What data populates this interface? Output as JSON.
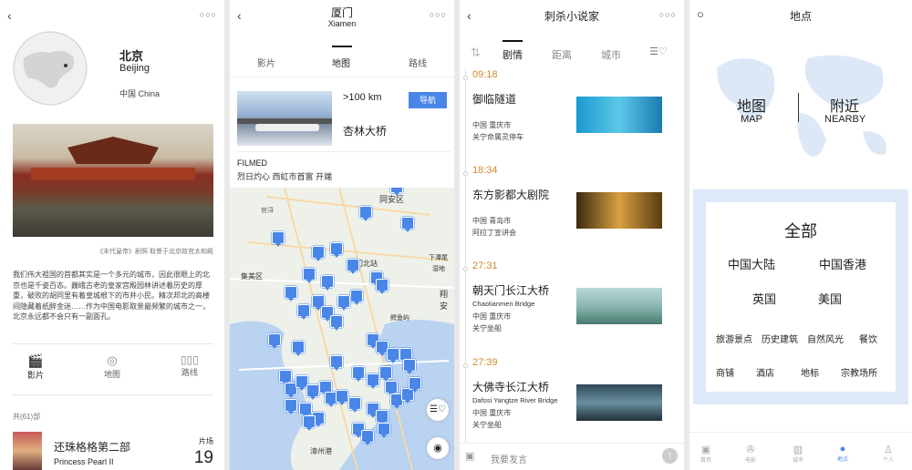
{
  "p1": {
    "city_cn": "北京",
    "city_en": "Beijing",
    "country": "中国 China",
    "caption": "《末代皇帝》剧照 取景于北京故宫太和殿",
    "description": "我们伟大祖国的首都其实是一个多元的城市，因此很眼上的北京也是千姿百态。巍峨古老的皇家宫殿园林讲述着历史的厚重，破败的胡同里有着皇城根下的市井小民。精次邦北的高楼间隐藏着纸醉金迷……作为中国电影取景最频繁的城市之一，北京永远都不会只有一副面孔。",
    "tabs": [
      "影片",
      "地图",
      "路线"
    ],
    "count_label": "共(61)部",
    "movie_cn": "还珠格格第二部",
    "movie_en": "Princess Pearl II",
    "scene_label": "片场",
    "scene_count": "19"
  },
  "p2": {
    "title_cn": "厦门",
    "title_en": "Xiamen",
    "tabs": [
      "影片",
      "地图",
      "路线"
    ],
    "distance": ">100 km",
    "nav_button": "导航",
    "place": "杏林大桥",
    "filmed_label": "FILMED",
    "filmed_detail": "烈日灼心 西虹市首富 开端",
    "map_labels": [
      "同安区",
      "官浔",
      "集美区",
      "漳州港",
      "厦门北站",
      "鳄鱼屿",
      "翔安",
      "下潭尾",
      "湿地"
    ]
  },
  "p3": {
    "title": "刺杀小说家",
    "tabs": [
      "剧情",
      "距离",
      "城市"
    ],
    "items": [
      {
        "time": "09:18",
        "title": "御临隧道",
        "sub": "",
        "loc": "中国 重庆市",
        "addr": "关宁命属灵停车"
      },
      {
        "time": "18:34",
        "title": "东方影都大剧院",
        "sub": "",
        "loc": "中国 青岛市",
        "addr": "阿拉丁宣讲会"
      },
      {
        "time": "27:31",
        "title": "朝天门长江大桥",
        "sub": "Chaotianmen Bridge",
        "loc": "中国 重庆市",
        "addr": "关宁坐船"
      },
      {
        "time": "27:39",
        "title": "大佛寺长江大桥",
        "sub": "Dafosi Yangtze River Bridge",
        "loc": "中国 重庆市",
        "addr": "关宁坐船"
      }
    ],
    "input_placeholder": "我要发言"
  },
  "p4": {
    "title": "地点",
    "map_cn": "地图",
    "map_en": "MAP",
    "nearby_cn": "附近",
    "nearby_en": "NEARBY",
    "all": "全部",
    "regions": [
      "中国大陆",
      "中国香港",
      "英国",
      "美国"
    ],
    "categories": [
      "旅游景点",
      "历史建筑",
      "自然风光",
      "餐饮",
      "商铺",
      "酒店",
      "地标",
      "宗教场所"
    ],
    "tabbar": [
      "首页",
      "电影",
      "城市",
      "地点",
      "个人"
    ]
  },
  "colors": {
    "accent": "#4a86e8",
    "time_orange": "#d08a2a"
  }
}
